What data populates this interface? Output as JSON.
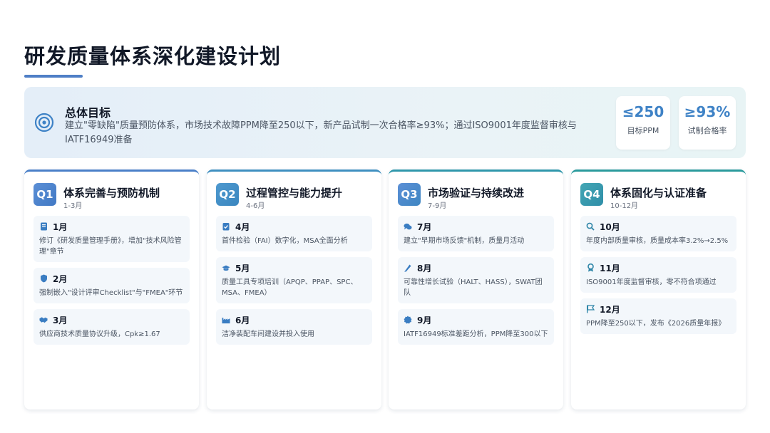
{
  "page": {
    "title": "研发质量体系深化建设计划"
  },
  "goal": {
    "heading": "总体目标",
    "text": "建立\"零缺陷\"质量预防体系，市场技术故障PPM降至250以下，新产品试制一次合格率≥93%；通过ISO9001年度监督审核与IATF16949准备",
    "icon": "target-icon",
    "metrics": [
      {
        "value": "≤250",
        "label": "目标PPM"
      },
      {
        "value": "≥93%",
        "label": "试制合格率"
      }
    ]
  },
  "quarters": [
    {
      "badge": "Q1",
      "title": "体系完善与预防机制",
      "months": "1-3月",
      "items": [
        {
          "icon": "book-icon",
          "month": "1月",
          "desc": "修订《研发质量管理手册》，增加\"技术风险管理\"章节"
        },
        {
          "icon": "shield-icon",
          "month": "2月",
          "desc": "强制嵌入\"设计评审Checklist\"与\"FMEA\"环节"
        },
        {
          "icon": "handshake-icon",
          "month": "3月",
          "desc": "供应商技术质量协议升级，Cpk≥1.67"
        }
      ]
    },
    {
      "badge": "Q2",
      "title": "过程管控与能力提升",
      "months": "4-6月",
      "items": [
        {
          "icon": "clipboard-check-icon",
          "month": "4月",
          "desc": "首件检验（FAI）数字化，MSA全面分析"
        },
        {
          "icon": "graduation-cap-icon",
          "month": "5月",
          "desc": "质量工具专项培训（APQP、PPAP、SPC、MSA、FMEA）"
        },
        {
          "icon": "factory-icon",
          "month": "6月",
          "desc": "洁净装配车间建设并投入使用"
        }
      ]
    },
    {
      "badge": "Q3",
      "title": "市场验证与持续改进",
      "months": "7-9月",
      "items": [
        {
          "icon": "comments-icon",
          "month": "7月",
          "desc": "建立\"早期市场反馈\"机制，质量月活动"
        },
        {
          "icon": "flask-icon",
          "month": "8月",
          "desc": "可靠性增长试验（HALT、HASS），SWAT团队"
        },
        {
          "icon": "certificate-icon",
          "month": "9月",
          "desc": "IATF16949标准差距分析，PPM降至300以下"
        }
      ]
    },
    {
      "badge": "Q4",
      "title": "体系固化与认证准备",
      "months": "10-12月",
      "items": [
        {
          "icon": "magnifier-icon",
          "month": "10月",
          "desc": "年度内部质量审核，质量成本率3.2%→2.5%"
        },
        {
          "icon": "award-icon",
          "month": "11月",
          "desc": "ISO9001年度监督审核，零不符合项通过"
        },
        {
          "icon": "flag-icon",
          "month": "12月",
          "desc": "PPM降至250以下，发布《2026质量年报》"
        }
      ]
    }
  ],
  "colors": {
    "accent": "#3e82c6",
    "teal": "#2a9a9c",
    "title_underline": "#4f7fc6"
  }
}
